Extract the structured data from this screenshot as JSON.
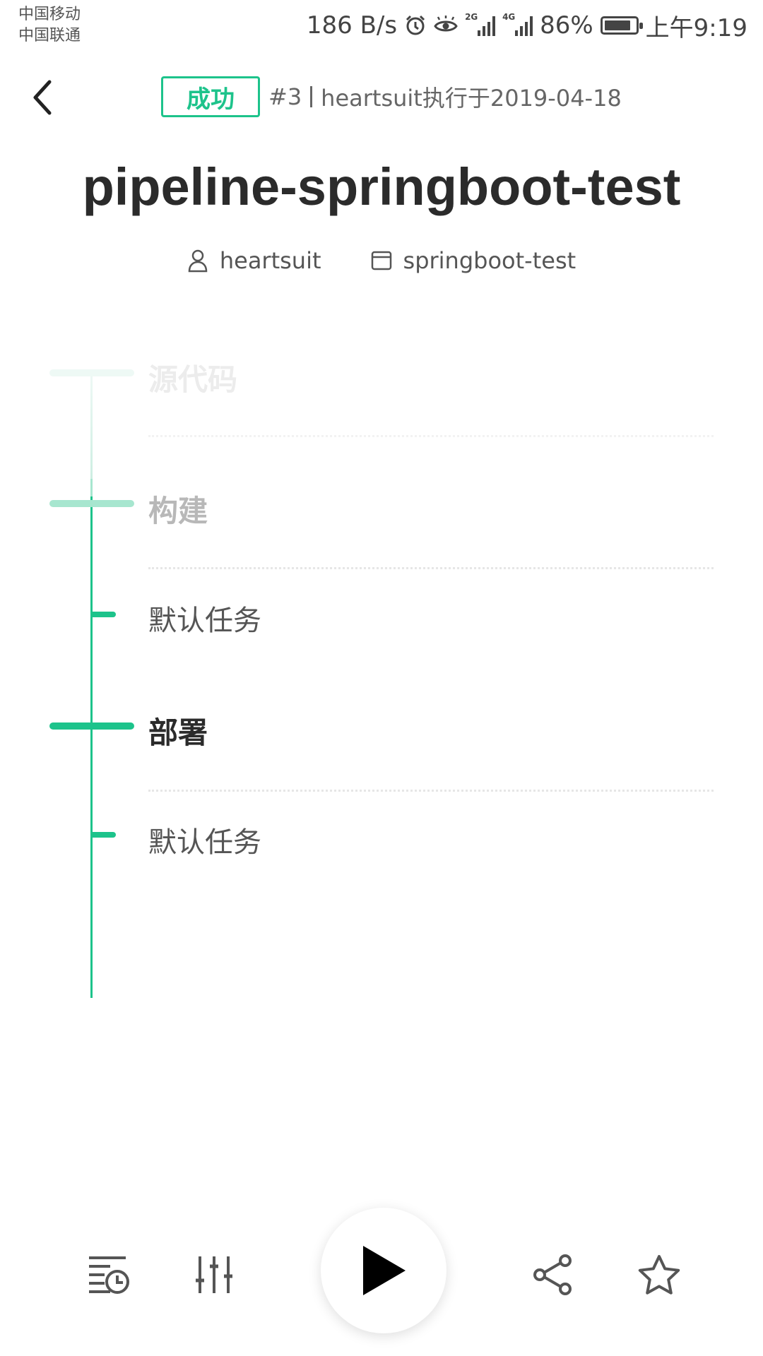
{
  "status_bar": {
    "carrier_1": "中国移动",
    "carrier_2": "中国联通",
    "speed": "186 B/s",
    "net_1": "2G",
    "net_2": "4G",
    "battery_percent": "86%",
    "battery_level": 0.86,
    "time": "上午9:19"
  },
  "header": {
    "status_badge": "成功",
    "run_number": "#3",
    "executed_by": "heartsuit执行于2019-04-18"
  },
  "pipeline": {
    "title": "pipeline-springboot-test",
    "user": "heartsuit",
    "repo": "springboot-test"
  },
  "stages": [
    {
      "name": "源代码",
      "tasks": []
    },
    {
      "name": "构建",
      "tasks": [
        "默认任务"
      ]
    },
    {
      "name": "部署",
      "tasks": [
        "默认任务"
      ]
    }
  ],
  "colors": {
    "accent": "#1dc38b",
    "text_dark": "#2b2b2b",
    "text_muted": "#666666"
  },
  "bottom_bar": {
    "icons": [
      "history-icon",
      "sliders-icon",
      "play-icon",
      "share-icon",
      "star-icon"
    ]
  }
}
